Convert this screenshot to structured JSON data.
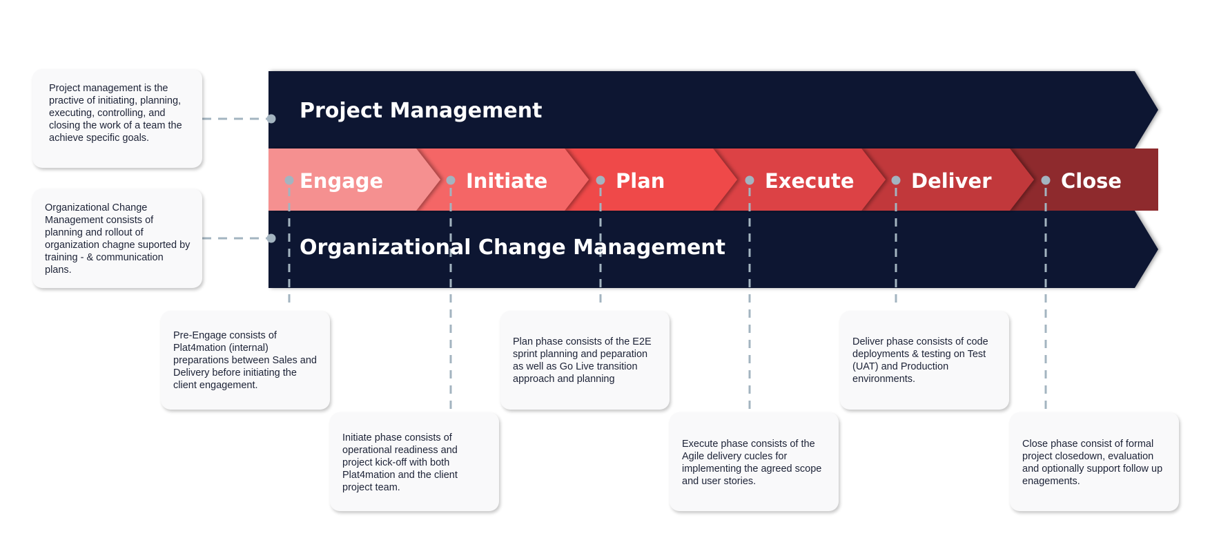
{
  "colors": {
    "navy": "#111833",
    "connector": "#a3b4c0",
    "note_bg": "#f9f9fa",
    "note_text": "#1c2236",
    "phase_colors": [
      "#f59090",
      "#f46666",
      "#ef4848",
      "#dc4245",
      "#c1373a",
      "#8e2a2d"
    ]
  },
  "bands": {
    "project_management": {
      "label": "Project Management"
    },
    "org_change_management": {
      "label": "Organizational Change Management"
    }
  },
  "phases": [
    {
      "label": "Engage",
      "description": "Pre-Engage consists of Plat4mation (internal) preparations between Sales and Delivery before initiating the client engagement."
    },
    {
      "label": "Initiate",
      "description": "Initiate phase consists of operational readiness and project kick-off with both Plat4mation and the client project team."
    },
    {
      "label": "Plan",
      "description": "Plan phase consists of the E2E sprint planning and peparation as well as Go Live transition approach and planning"
    },
    {
      "label": "Execute",
      "description": "Execute phase consists of the Agile delivery cucles for implementing the agreed scope and user stories."
    },
    {
      "label": "Deliver",
      "description": "Deliver phase consists of code deployments & testing on Test (UAT) and Production environments."
    },
    {
      "label": "Close",
      "description": "Close phase consist of formal project closedown, evaluation and optionally support follow up enagements."
    }
  ],
  "side_notes": {
    "project_management": "Project management is the practive of initiating, planning, executing, controlling, and closing the work of a team the achieve specific goals.",
    "org_change_management": "Organizational Change Management consists of planning and rollout of organization chagne suported by training - & communication plans."
  }
}
